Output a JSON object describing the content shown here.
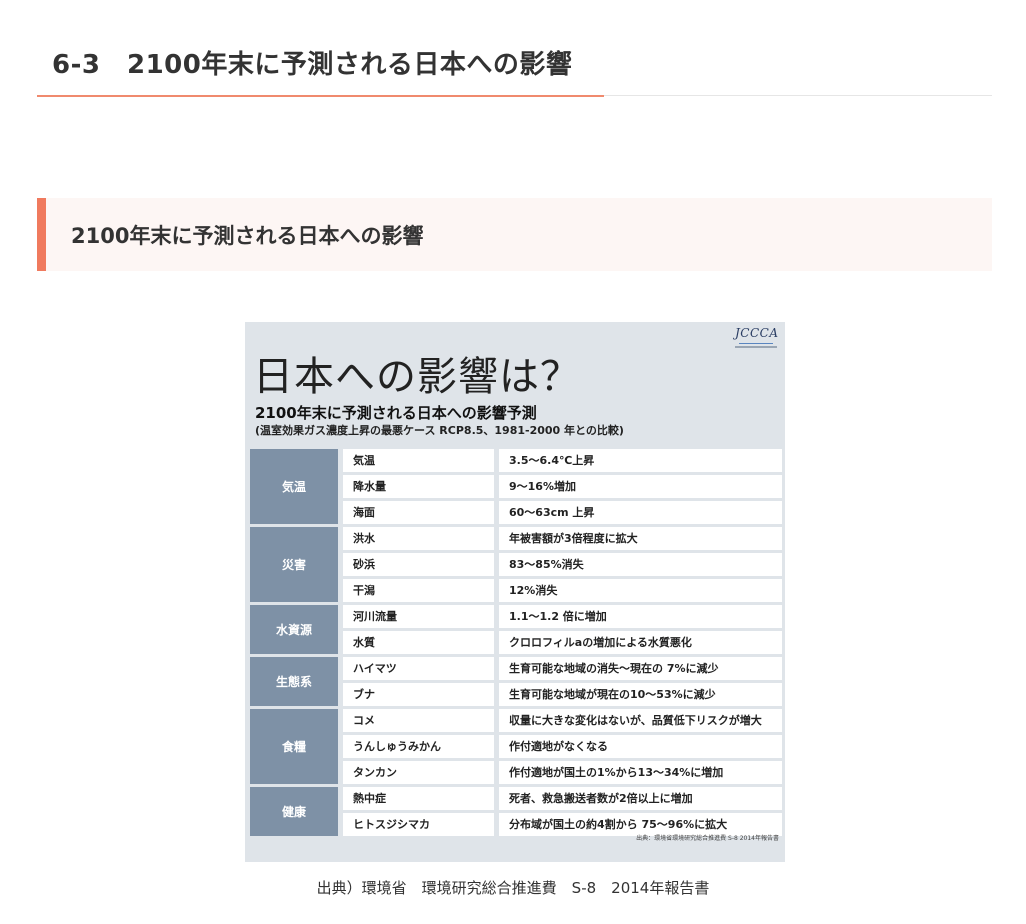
{
  "page": {
    "heading": "6-3　2100年末に予測される日本への影響",
    "section_title": "2100年末に予測される日本への影響",
    "caption": "出典）環境省　環境研究総合推進費　S-8　2014年報告書"
  },
  "figure": {
    "logo_text": "JCCCA",
    "title": "日本への影響は？",
    "subtitle": "2100年末に予測される日本への影響予測",
    "note": "(温室効果ガス濃度上昇の最悪ケース RCP8.5、1981-2000 年との比較)",
    "source": "出典：環境省環境研究総合推進費 S-8 2014年報告書",
    "groups": [
      {
        "label": "気温",
        "rows": [
          {
            "item": "気温",
            "effect": "3.5～6.4℃上昇"
          },
          {
            "item": "降水量",
            "effect": "9～16%増加"
          },
          {
            "item": "海面",
            "effect": "60～63cm 上昇"
          }
        ]
      },
      {
        "label": "災害",
        "rows": [
          {
            "item": "洪水",
            "effect": "年被害額が3倍程度に拡大"
          },
          {
            "item": "砂浜",
            "effect": "83～85%消失"
          },
          {
            "item": "干潟",
            "effect": "12%消失"
          }
        ]
      },
      {
        "label": "水資源",
        "rows": [
          {
            "item": "河川流量",
            "effect": "1.1～1.2 倍に増加"
          },
          {
            "item": "水質",
            "effect": "クロロフィルaの増加による水質悪化"
          }
        ]
      },
      {
        "label": "生態系",
        "rows": [
          {
            "item": "ハイマツ",
            "effect": "生育可能な地域の消失～現在の 7%に減少"
          },
          {
            "item": "ブナ",
            "effect": "生育可能な地域が現在の10～53%に減少"
          }
        ]
      },
      {
        "label": "食糧",
        "rows": [
          {
            "item": "コメ",
            "effect": "収量に大きな変化はないが、品質低下リスクが増大"
          },
          {
            "item": "うんしゅうみかん",
            "effect": "作付適地がなくなる"
          },
          {
            "item": "タンカン",
            "effect": "作付適地が国土の1%から13～34%に増加"
          }
        ]
      },
      {
        "label": "健康",
        "rows": [
          {
            "item": "熱中症",
            "effect": "死者、救急搬送者数が2倍以上に増加"
          },
          {
            "item": "ヒトスジシマカ",
            "effect": "分布域が国土の約4割から 75～96%に拡大"
          }
        ]
      }
    ]
  }
}
